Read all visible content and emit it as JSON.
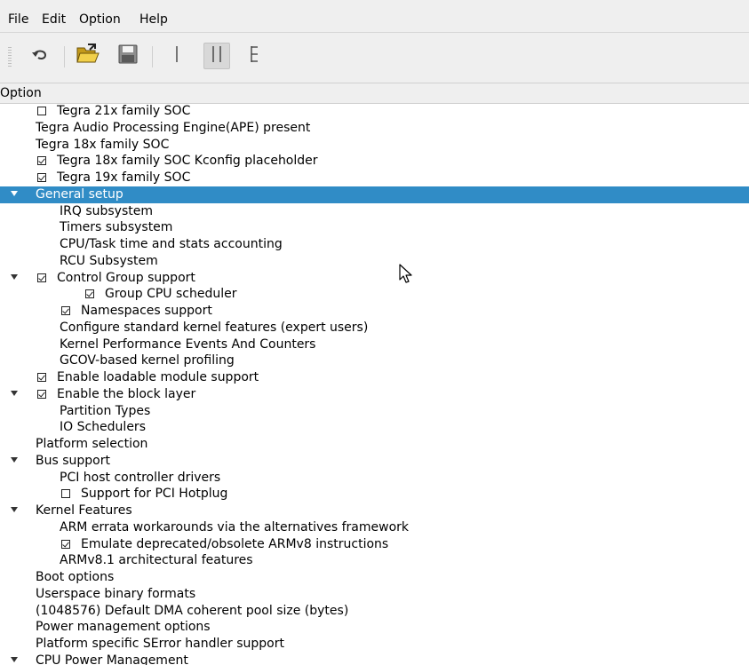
{
  "menubar": {
    "file": "File",
    "edit": "Edit",
    "option": "Option",
    "help": "Help"
  },
  "toolbar": {
    "buttons": [
      {
        "icon": "undo-icon"
      },
      {
        "icon": "open-folder-icon"
      },
      {
        "icon": "save-icon"
      },
      {
        "icon": "single-view-icon"
      },
      {
        "icon": "split-view-icon",
        "checked": true
      },
      {
        "icon": "full-view-icon"
      }
    ]
  },
  "header": {
    "column": "Option"
  },
  "colors": {
    "selection": "#308cc6",
    "chrome": "#efefef"
  },
  "tree": {
    "rows": [
      {
        "label": "Tegra 21x family SOC",
        "depth": 1,
        "check": "unchecked"
      },
      {
        "label": "Tegra Audio Processing Engine(APE) present",
        "depth": 1
      },
      {
        "label": "Tegra 18x family SOC",
        "depth": 1
      },
      {
        "label": "Tegra 18x family SOC Kconfig placeholder",
        "depth": 1,
        "check": "checked"
      },
      {
        "label": "Tegra 19x family SOC",
        "depth": 1,
        "check": "checked"
      },
      {
        "label": "General setup",
        "depth": 0,
        "expanded": true,
        "selected": true
      },
      {
        "label": "IRQ subsystem",
        "depth": 2
      },
      {
        "label": "Timers subsystem",
        "depth": 2
      },
      {
        "label": "CPU/Task time and stats accounting",
        "depth": 2
      },
      {
        "label": "RCU Subsystem",
        "depth": 2
      },
      {
        "label": "Control Group support",
        "depth": 1,
        "expanded": true,
        "check": "checked"
      },
      {
        "label": "Group CPU scheduler",
        "depth": 2,
        "check": "checked"
      },
      {
        "label": "Namespaces support",
        "depth": 2,
        "check": "checked"
      },
      {
        "label": "Configure standard kernel features (expert users)",
        "depth": 2
      },
      {
        "label": "Kernel Performance Events And Counters",
        "depth": 2
      },
      {
        "label": "GCOV-based kernel profiling",
        "depth": 2
      },
      {
        "label": "Enable loadable module support",
        "depth": 1,
        "check": "checked"
      },
      {
        "label": "Enable the block layer",
        "depth": 0,
        "expanded": true,
        "check": "checked"
      },
      {
        "label": "Partition Types",
        "depth": 2
      },
      {
        "label": "IO Schedulers",
        "depth": 2
      },
      {
        "label": "Platform selection",
        "depth": 1
      },
      {
        "label": "Bus support",
        "depth": 0,
        "expanded": true
      },
      {
        "label": "PCI host controller drivers",
        "depth": 2
      },
      {
        "label": "Support for PCI Hotplug",
        "depth": 2,
        "check": "unchecked"
      },
      {
        "label": "Kernel Features",
        "depth": 0,
        "expanded": true
      },
      {
        "label": "ARM errata workarounds via the alternatives framework",
        "depth": 2
      },
      {
        "label": "Emulate deprecated/obsolete ARMv8 instructions",
        "depth": 2,
        "check": "checked"
      },
      {
        "label": "ARMv8.1 architectural features",
        "depth": 2
      },
      {
        "label": "Boot options",
        "depth": 1
      },
      {
        "label": "Userspace binary formats",
        "depth": 1
      },
      {
        "label": "(1048576) Default  DMA coherent pool size (bytes)",
        "depth": 1
      },
      {
        "label": "Power management options",
        "depth": 1
      },
      {
        "label": "Platform specific SError handler support",
        "depth": 1
      },
      {
        "label": "CPU Power Management",
        "depth": 0,
        "expanded": true
      }
    ]
  }
}
